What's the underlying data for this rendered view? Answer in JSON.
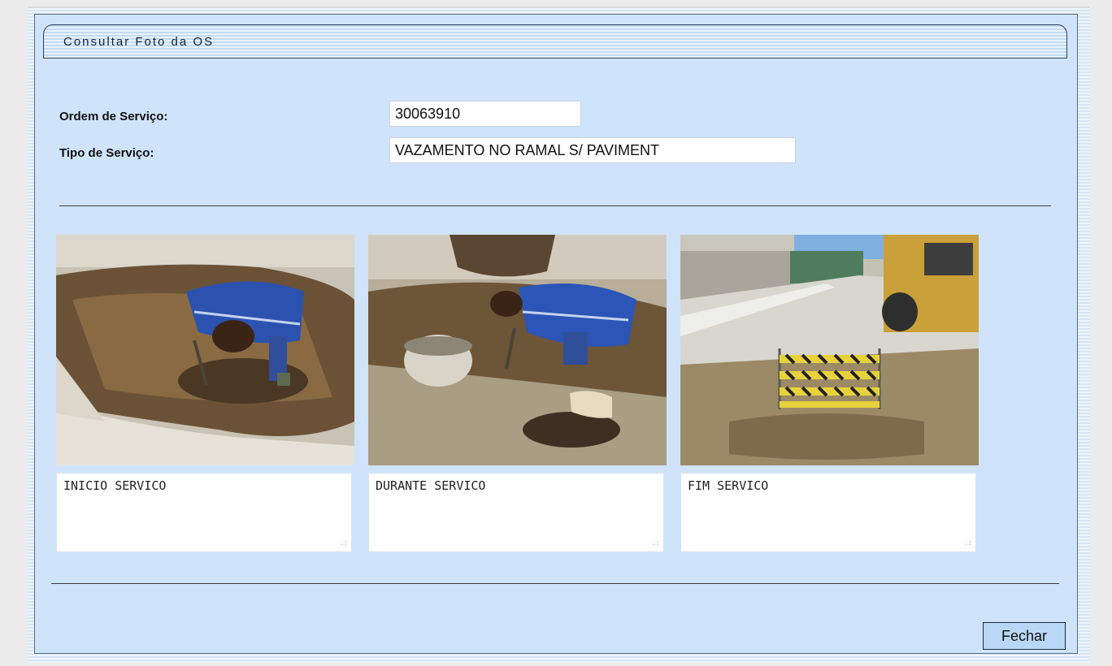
{
  "form": {
    "title": "Consultar Foto da OS",
    "ordem_label": "Ordem de Serviço:",
    "ordem_value": "30063910",
    "tipo_label": "Tipo de Serviço:",
    "tipo_value": "VAZAMENTO NO RAMAL S/ PAVIMENT"
  },
  "photos": [
    {
      "caption": "INICIO SERVICO",
      "subject": "worker-digging-photo"
    },
    {
      "caption": "DURANTE SERVICO",
      "subject": "worker-with-bucket-photo"
    },
    {
      "caption": "FIM SERVICO",
      "subject": "street-barrier-photo"
    }
  ],
  "buttons": {
    "close_label": "Fechar"
  }
}
